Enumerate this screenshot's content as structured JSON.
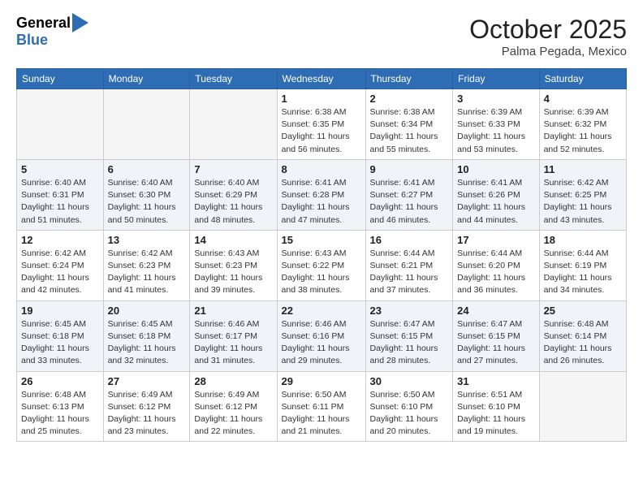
{
  "header": {
    "logo_general": "General",
    "logo_blue": "Blue",
    "month_title": "October 2025",
    "location": "Palma Pegada, Mexico"
  },
  "days_of_week": [
    "Sunday",
    "Monday",
    "Tuesday",
    "Wednesday",
    "Thursday",
    "Friday",
    "Saturday"
  ],
  "weeks": [
    {
      "shade": false,
      "days": [
        {
          "num": "",
          "info": ""
        },
        {
          "num": "",
          "info": ""
        },
        {
          "num": "",
          "info": ""
        },
        {
          "num": "1",
          "info": "Sunrise: 6:38 AM\nSunset: 6:35 PM\nDaylight: 11 hours\nand 56 minutes."
        },
        {
          "num": "2",
          "info": "Sunrise: 6:38 AM\nSunset: 6:34 PM\nDaylight: 11 hours\nand 55 minutes."
        },
        {
          "num": "3",
          "info": "Sunrise: 6:39 AM\nSunset: 6:33 PM\nDaylight: 11 hours\nand 53 minutes."
        },
        {
          "num": "4",
          "info": "Sunrise: 6:39 AM\nSunset: 6:32 PM\nDaylight: 11 hours\nand 52 minutes."
        }
      ]
    },
    {
      "shade": true,
      "days": [
        {
          "num": "5",
          "info": "Sunrise: 6:40 AM\nSunset: 6:31 PM\nDaylight: 11 hours\nand 51 minutes."
        },
        {
          "num": "6",
          "info": "Sunrise: 6:40 AM\nSunset: 6:30 PM\nDaylight: 11 hours\nand 50 minutes."
        },
        {
          "num": "7",
          "info": "Sunrise: 6:40 AM\nSunset: 6:29 PM\nDaylight: 11 hours\nand 48 minutes."
        },
        {
          "num": "8",
          "info": "Sunrise: 6:41 AM\nSunset: 6:28 PM\nDaylight: 11 hours\nand 47 minutes."
        },
        {
          "num": "9",
          "info": "Sunrise: 6:41 AM\nSunset: 6:27 PM\nDaylight: 11 hours\nand 46 minutes."
        },
        {
          "num": "10",
          "info": "Sunrise: 6:41 AM\nSunset: 6:26 PM\nDaylight: 11 hours\nand 44 minutes."
        },
        {
          "num": "11",
          "info": "Sunrise: 6:42 AM\nSunset: 6:25 PM\nDaylight: 11 hours\nand 43 minutes."
        }
      ]
    },
    {
      "shade": false,
      "days": [
        {
          "num": "12",
          "info": "Sunrise: 6:42 AM\nSunset: 6:24 PM\nDaylight: 11 hours\nand 42 minutes."
        },
        {
          "num": "13",
          "info": "Sunrise: 6:42 AM\nSunset: 6:23 PM\nDaylight: 11 hours\nand 41 minutes."
        },
        {
          "num": "14",
          "info": "Sunrise: 6:43 AM\nSunset: 6:23 PM\nDaylight: 11 hours\nand 39 minutes."
        },
        {
          "num": "15",
          "info": "Sunrise: 6:43 AM\nSunset: 6:22 PM\nDaylight: 11 hours\nand 38 minutes."
        },
        {
          "num": "16",
          "info": "Sunrise: 6:44 AM\nSunset: 6:21 PM\nDaylight: 11 hours\nand 37 minutes."
        },
        {
          "num": "17",
          "info": "Sunrise: 6:44 AM\nSunset: 6:20 PM\nDaylight: 11 hours\nand 36 minutes."
        },
        {
          "num": "18",
          "info": "Sunrise: 6:44 AM\nSunset: 6:19 PM\nDaylight: 11 hours\nand 34 minutes."
        }
      ]
    },
    {
      "shade": true,
      "days": [
        {
          "num": "19",
          "info": "Sunrise: 6:45 AM\nSunset: 6:18 PM\nDaylight: 11 hours\nand 33 minutes."
        },
        {
          "num": "20",
          "info": "Sunrise: 6:45 AM\nSunset: 6:18 PM\nDaylight: 11 hours\nand 32 minutes."
        },
        {
          "num": "21",
          "info": "Sunrise: 6:46 AM\nSunset: 6:17 PM\nDaylight: 11 hours\nand 31 minutes."
        },
        {
          "num": "22",
          "info": "Sunrise: 6:46 AM\nSunset: 6:16 PM\nDaylight: 11 hours\nand 29 minutes."
        },
        {
          "num": "23",
          "info": "Sunrise: 6:47 AM\nSunset: 6:15 PM\nDaylight: 11 hours\nand 28 minutes."
        },
        {
          "num": "24",
          "info": "Sunrise: 6:47 AM\nSunset: 6:15 PM\nDaylight: 11 hours\nand 27 minutes."
        },
        {
          "num": "25",
          "info": "Sunrise: 6:48 AM\nSunset: 6:14 PM\nDaylight: 11 hours\nand 26 minutes."
        }
      ]
    },
    {
      "shade": false,
      "days": [
        {
          "num": "26",
          "info": "Sunrise: 6:48 AM\nSunset: 6:13 PM\nDaylight: 11 hours\nand 25 minutes."
        },
        {
          "num": "27",
          "info": "Sunrise: 6:49 AM\nSunset: 6:12 PM\nDaylight: 11 hours\nand 23 minutes."
        },
        {
          "num": "28",
          "info": "Sunrise: 6:49 AM\nSunset: 6:12 PM\nDaylight: 11 hours\nand 22 minutes."
        },
        {
          "num": "29",
          "info": "Sunrise: 6:50 AM\nSunset: 6:11 PM\nDaylight: 11 hours\nand 21 minutes."
        },
        {
          "num": "30",
          "info": "Sunrise: 6:50 AM\nSunset: 6:10 PM\nDaylight: 11 hours\nand 20 minutes."
        },
        {
          "num": "31",
          "info": "Sunrise: 6:51 AM\nSunset: 6:10 PM\nDaylight: 11 hours\nand 19 minutes."
        },
        {
          "num": "",
          "info": ""
        }
      ]
    }
  ]
}
